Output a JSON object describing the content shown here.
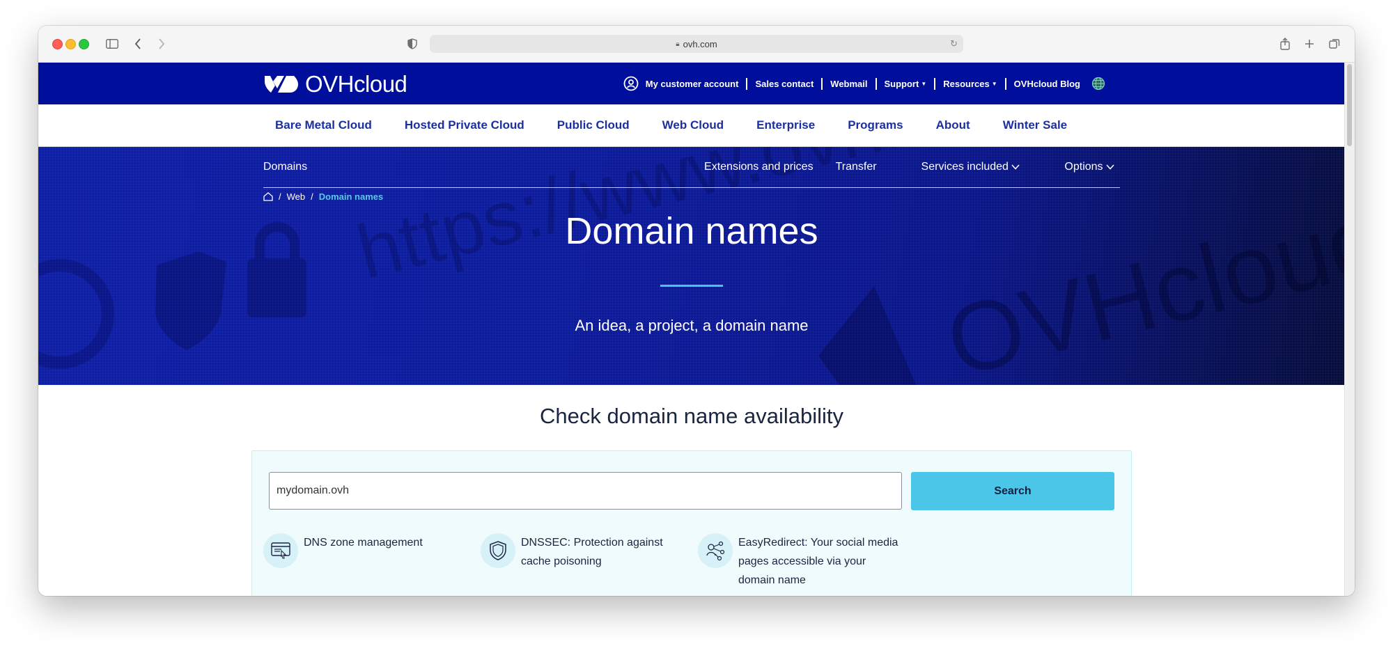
{
  "browser": {
    "url": "ovh.com"
  },
  "header": {
    "logo_text": "OVHcloud",
    "links": [
      {
        "label": "My customer account",
        "caret": false
      },
      {
        "label": "Sales contact",
        "caret": false
      },
      {
        "label": "Webmail",
        "caret": false
      },
      {
        "label": "Support",
        "caret": true
      },
      {
        "label": "Resources",
        "caret": true
      },
      {
        "label": "OVHcloud Blog",
        "caret": false
      }
    ]
  },
  "main_nav": {
    "items": [
      "Bare Metal Cloud",
      "Hosted Private Cloud",
      "Public Cloud",
      "Web Cloud",
      "Enterprise",
      "Programs",
      "About",
      "Winter Sale"
    ]
  },
  "sub_nav": {
    "section": "Domains",
    "items": [
      "Extensions and prices",
      "Transfer",
      "Services included",
      "Options"
    ]
  },
  "breadcrumb": {
    "items": [
      "Web",
      "Domain names"
    ]
  },
  "hero": {
    "title": "Domain names",
    "subtitle": "An idea, a project, a domain name",
    "bg_text": "https://www.ovh.com"
  },
  "availability": {
    "title": "Check domain name availability",
    "input_value": "mydomain.ovh",
    "search_label": "Search",
    "features": [
      {
        "icon": "dns-zone-icon",
        "text": "DNS zone management"
      },
      {
        "icon": "shield-icon",
        "text": "DNSSEC: Protection against cache poisoning"
      },
      {
        "icon": "redirect-network-icon",
        "text": "EasyRedirect: Your social media pages accessible via your domain name"
      }
    ]
  },
  "colors": {
    "brand_blue": "#000e9c",
    "accent_cyan": "#4bc6e8",
    "nav_text": "#1b2f9e"
  }
}
